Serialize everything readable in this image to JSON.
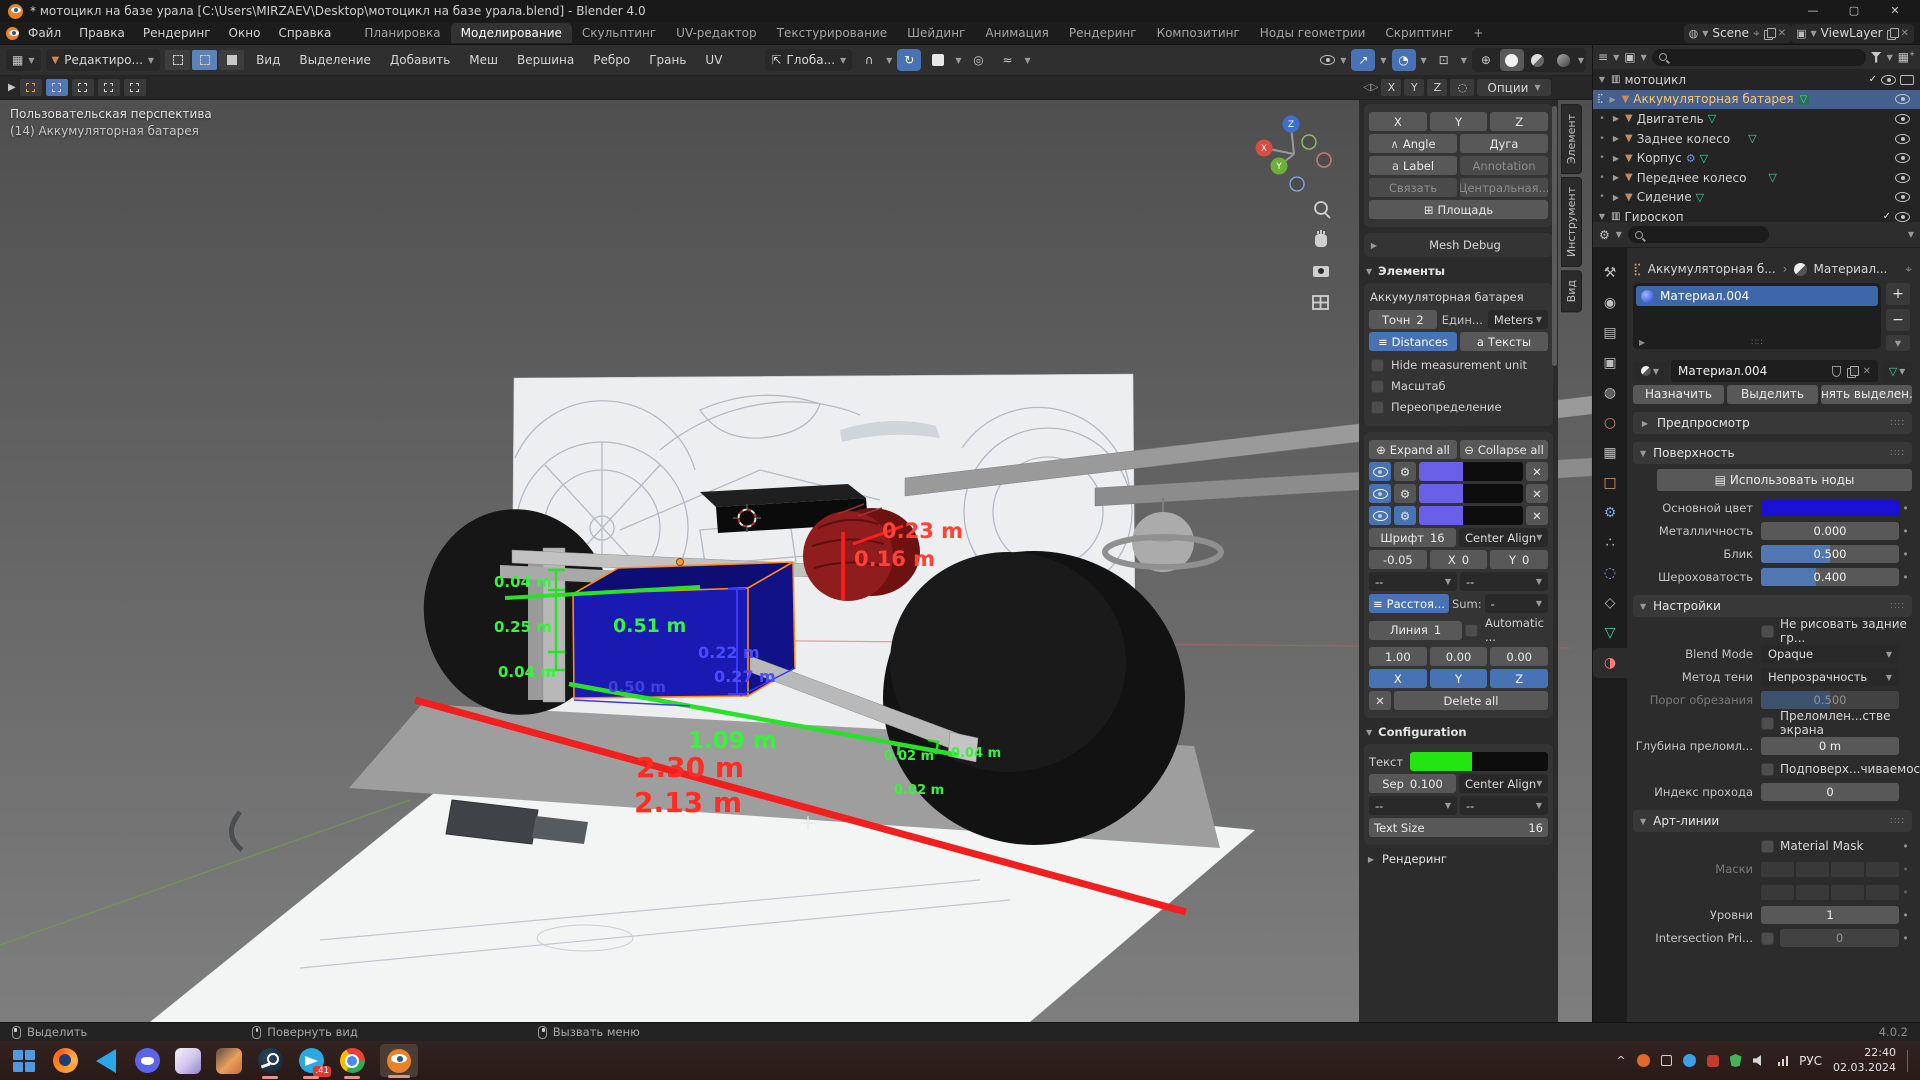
{
  "window": {
    "title": "* мотоцикл на базе урала [C:\\Users\\MIRZAEV\\Desktop\\мотоцикл на базе урала.blend] - Blender 4.0",
    "minimize": "—",
    "maximize": "▢",
    "close": "✕"
  },
  "menubar": {
    "items": [
      "Файл",
      "Правка",
      "Рендеринг",
      "Окно",
      "Справка"
    ]
  },
  "workspaces": {
    "tabs": [
      "Планировка",
      "Моделирование",
      "Скульптинг",
      "UV-редактор",
      "Текстурирование",
      "Шейдинг",
      "Анимация",
      "Рендеринг",
      "Композитинг",
      "Ноды геометрии",
      "Скриптинг"
    ],
    "active": "Моделирование",
    "add": "+"
  },
  "scene_widget": {
    "scene": "Scene",
    "view_layer": "ViewLayer"
  },
  "viewport_header": {
    "mode": "Редактиро...",
    "menus": [
      "Вид",
      "Выделение",
      "Добавить",
      "Меш",
      "Вершина",
      "Ребро",
      "Грань",
      "UV"
    ],
    "orientation": "Глоба..."
  },
  "tool_settings": {
    "x": "X",
    "y": "Y",
    "z": "Z",
    "options": "Опции"
  },
  "viewport": {
    "view_label": "Пользовательская перспектива",
    "object_label": "(14) Аккумуляторная батарея",
    "gizmo": {
      "x": "X",
      "y": "Y",
      "z": "Z"
    },
    "measurements": [
      {
        "text": "0.23 m",
        "color": "#ff4136"
      },
      {
        "text": "0.16 m",
        "color": "#ff4136"
      },
      {
        "text": "0.04 m",
        "color": "#35f53a"
      },
      {
        "text": "0.25 m",
        "color": "#35f53a"
      },
      {
        "text": "0.04 m",
        "color": "#35f53a"
      },
      {
        "text": "0.51 m",
        "color": "#35f53a"
      },
      {
        "text": "0.50 m",
        "color": "#4040e0"
      },
      {
        "text": "0.22 m",
        "color": "#4b4bff"
      },
      {
        "text": "0.27 m",
        "color": "#4b4bff"
      },
      {
        "text": "1.09 m",
        "color": "#35f53a"
      },
      {
        "text": "2.30 m",
        "color": "#ff2d23"
      },
      {
        "text": "2.13 m",
        "color": "#ff2d23"
      },
      {
        "text": "0.02 m",
        "color": "#35f53a"
      },
      {
        "text": "0.04 m",
        "color": "#35f53a"
      },
      {
        "text": "0.02 m",
        "color": "#35f53a"
      }
    ]
  },
  "side_tabs": {
    "items": [
      "Элемент",
      "Инструмент",
      "Вид"
    ]
  },
  "measure_panel": {
    "axis_row": {
      "x": "X",
      "y": "Y",
      "z": "Z",
      "options": "Опции"
    },
    "tools": {
      "x": "X",
      "y": "Y",
      "z": "Z",
      "angle": "Angle",
      "arc": "Дуга",
      "label": "Label",
      "annotation": "Annotation",
      "link": "Связать",
      "origin": "Центральная...",
      "area": "Площадь",
      "mesh_debug": "Mesh Debug"
    },
    "items": {
      "title": "Элементы",
      "object_name": "Аккумуляторная батарея",
      "precision_label": "Точн",
      "precision": "2",
      "units_label": "Един...",
      "units": "Meters",
      "distances": "Distances",
      "texts": "Тексты",
      "hide_units": "Hide measurement unit",
      "scale": "Масштаб",
      "override": "Переопределение",
      "expand_all": "Expand all",
      "collapse_all": "Collapse all",
      "font_label": "Шрифт",
      "font_size": "16",
      "align": "Center Align",
      "offset": "-0.05",
      "x_label": "X",
      "x_value": "0",
      "y_label": "Y",
      "y_value": "0",
      "dropdown_empty": "--",
      "distance_toggle": "Расстоя...",
      "sum_label": "Sum:",
      "sum_value": "-",
      "line_label": "Линия",
      "line_value": "1",
      "automatic": "Automatic ...",
      "vx": "1.00",
      "vy": "0.00",
      "vz": "0.00",
      "delete_all": "Delete all"
    },
    "config": {
      "title": "Configuration",
      "text_label": "Текст",
      "text_color": "#23e50f",
      "sep_label": "Sep",
      "sep_value": "0.100",
      "align": "Center Align",
      "dropdown_empty": "--",
      "text_size_label": "Text Size",
      "text_size": "16"
    },
    "render": {
      "title": "Рендеринг"
    }
  },
  "outliner": {
    "collection": "мотоцикл",
    "items": [
      {
        "name": "Аккумуляторная батарея"
      },
      {
        "name": "Двигатель"
      },
      {
        "name": "Заднее колесо"
      },
      {
        "name": "Корпус"
      },
      {
        "name": "Переднее колесо"
      },
      {
        "name": "Сидение"
      }
    ],
    "collection2": "Гироскоп"
  },
  "properties": {
    "breadcrumb": {
      "object": "Аккумуляторная б...",
      "material": "Материал..."
    },
    "slot_name": "Материал.004",
    "material_name": "Материал.004",
    "assign": "Назначить",
    "select": "Выделить",
    "deselect": "Снять выделен...",
    "preview": "Предпросмотр",
    "surface": {
      "title": "Поверхность",
      "use_nodes": "Использовать ноды",
      "base_color_label": "Основной цвет",
      "base_color": "#1b10d4",
      "metallic_label": "Металличность",
      "metallic": "0.000",
      "specular_label": "Блик",
      "specular": "0.500",
      "roughness_label": "Шероховатость",
      "roughness": "0.400"
    },
    "settings": {
      "title": "Настройки",
      "backface": "Не рисовать задние гр...",
      "blend_mode_label": "Blend Mode",
      "blend_mode": "Opaque",
      "shadow_label": "Метод тени",
      "shadow_mode": "Непрозрачность",
      "clip_label": "Порог обрезания",
      "clip": "0.500",
      "refraction": "Преломлен...стве экрана",
      "depth_label": "Глубина преломл...",
      "depth": "0 m",
      "subsurface": "Подповерх...чиваемость",
      "pass_label": "Индекс прохода",
      "pass_index": "0"
    },
    "line_art": {
      "title": "Арт-линии",
      "material_mask": "Material Mask",
      "masks_label": "Маски",
      "levels_label": "Уровни",
      "levels": "1",
      "intersection_label": "Intersection Pri...",
      "intersection": "0"
    }
  },
  "statusbar": {
    "select": "Выделить",
    "rotate": "Повернуть вид",
    "menu": "Вызвать меню",
    "version": "4.0.2"
  },
  "taskbar": {
    "telegram_badge": ".41",
    "tray": {
      "lang": "РУС",
      "time": "22:40",
      "date": "02.03.2024"
    }
  }
}
